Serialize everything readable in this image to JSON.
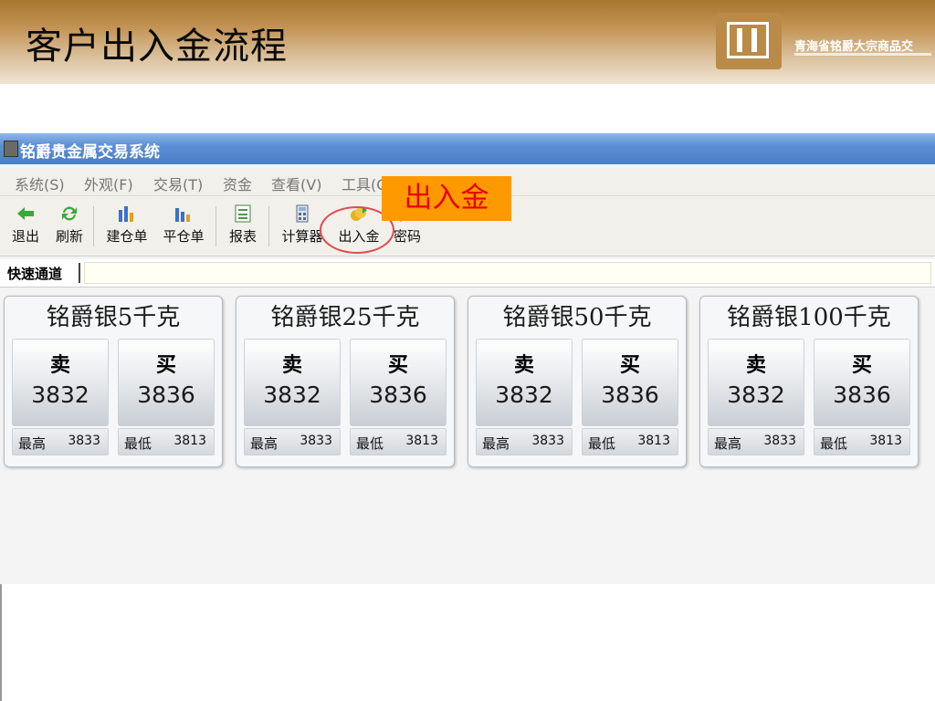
{
  "slide": {
    "title": "客户出入金流程",
    "company_name": "青海省铭爵大宗商品交"
  },
  "window": {
    "title": "铭爵贵金属交易系统"
  },
  "menu": [
    "系统(S)",
    "外观(F)",
    "交易(T)",
    "资金",
    "查看(V)",
    "工具(O)"
  ],
  "toolbar": [
    {
      "label": "退出",
      "icon": "exit-arrow-icon"
    },
    {
      "label": "刷新",
      "icon": "refresh-icon"
    },
    {
      "label": "建仓单",
      "icon": "bar-chart-icon"
    },
    {
      "label": "平仓单",
      "icon": "bar-chart-icon"
    },
    {
      "label": "报表",
      "icon": "report-icon"
    },
    {
      "label": "计算器",
      "icon": "calculator-icon"
    },
    {
      "label": "出入金",
      "icon": "money-icon"
    },
    {
      "label": "密码",
      "icon": "pencil-icon"
    }
  ],
  "annotation": "出入金",
  "quick_channel": "快速通道",
  "products": [
    {
      "name": "铭爵银5千克",
      "sell_label": "卖",
      "buy_label": "买",
      "sell": "3832",
      "buy": "3836",
      "high_label": "最高",
      "high": "3833",
      "low_label": "最低",
      "low": "3813"
    },
    {
      "name": "铭爵银25千克",
      "sell_label": "卖",
      "buy_label": "买",
      "sell": "3832",
      "buy": "3836",
      "high_label": "最高",
      "high": "3833",
      "low_label": "最低",
      "low": "3813"
    },
    {
      "name": "铭爵银50千克",
      "sell_label": "卖",
      "buy_label": "买",
      "sell": "3832",
      "buy": "3836",
      "high_label": "最高",
      "high": "3833",
      "low_label": "最低",
      "low": "3813"
    },
    {
      "name": "铭爵银100千克",
      "sell_label": "卖",
      "buy_label": "买",
      "sell": "3832",
      "buy": "3836",
      "high_label": "最高",
      "high": "3833",
      "low_label": "最低",
      "low": "3813"
    }
  ],
  "colors": {
    "annotation_bg": "#ff9900",
    "annotation_text": "#e60000",
    "titlebar": "#5a8fd4"
  }
}
